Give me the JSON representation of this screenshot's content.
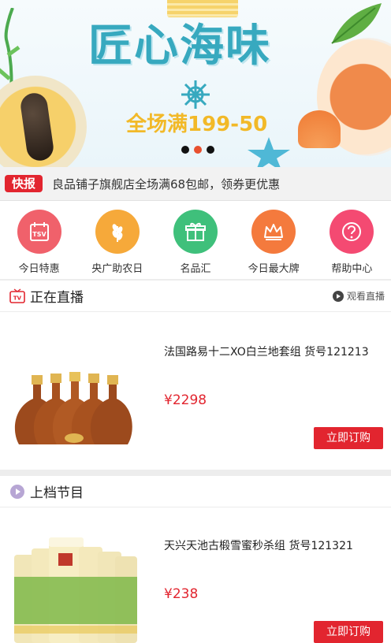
{
  "banner": {
    "title": "匠心海味",
    "promo": "全场满199-50",
    "slide_count": 3,
    "active_slide": 2
  },
  "ticker": {
    "badge": "快报",
    "message": "良品铺子旗舰店全场满68包邮，领券更优惠"
  },
  "categories": [
    {
      "label": "今日特惠",
      "icon": "tsv-calendar-icon",
      "color": "#f0616b"
    },
    {
      "label": "央广助农日",
      "icon": "wheat-icon",
      "color": "#f6a93a"
    },
    {
      "label": "名品汇",
      "icon": "gift-icon",
      "color": "#3fc07b"
    },
    {
      "label": "今日最大牌",
      "icon": "crown-icon",
      "color": "#f47a3d"
    },
    {
      "label": "帮助中心",
      "icon": "question-icon",
      "color": "#f44a72"
    }
  ],
  "live_section": {
    "title": "正在直播",
    "more_label": "观看直播",
    "icon_text": "TV"
  },
  "products": [
    {
      "name": "法国路易十二XO白兰地套组 货号121213",
      "price": "¥2298",
      "buy_label": "立即订购"
    },
    {
      "name": "天兴天池古椴雪蜜秒杀组 货号121321",
      "price": "¥238",
      "buy_label": "立即订购"
    }
  ],
  "prev_section": {
    "title": "上档节目"
  },
  "colors": {
    "accent": "#e2252f",
    "banner_title": "#37a9bf",
    "promo": "#f2b928"
  }
}
